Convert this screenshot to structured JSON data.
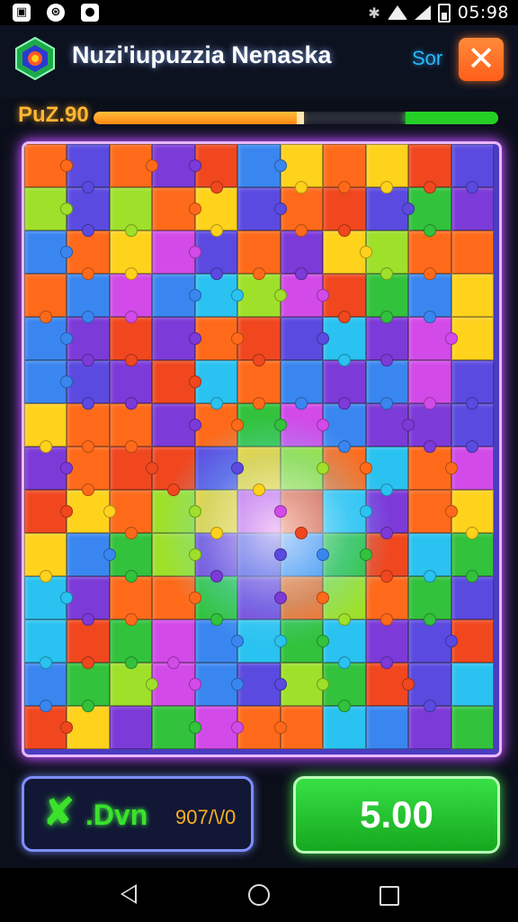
{
  "status_bar": {
    "time": "05:98",
    "icons": [
      "photo-icon",
      "messenger-icon",
      "app-icon",
      "bluetooth-icon",
      "wifi-icon",
      "signal-icon",
      "battery-icon"
    ]
  },
  "header": {
    "title": "Nuzi'iupuzzia Nenaska",
    "sort_label": "Sor",
    "close_symbol": "✕"
  },
  "progress": {
    "label": "PuZ.90",
    "fill_fraction": 0.51,
    "green_fraction": 0.23
  },
  "board": {
    "rows": 14,
    "cols": 11,
    "palette": [
      "#7c3ad8",
      "#5a4ae0",
      "#3a86f0",
      "#32c23c",
      "#ff6a1a",
      "#f0471f",
      "#ffd21c",
      "#d24ae8",
      "#2ac2f0",
      "#9ee02a"
    ]
  },
  "buttons": {
    "left": {
      "icon": "x-icon",
      "label": ".Dvn",
      "value": "907/\\/0"
    },
    "right": {
      "label": "5.00"
    }
  },
  "nav": {
    "icons": [
      "back-icon",
      "home-icon",
      "recents-icon"
    ]
  }
}
